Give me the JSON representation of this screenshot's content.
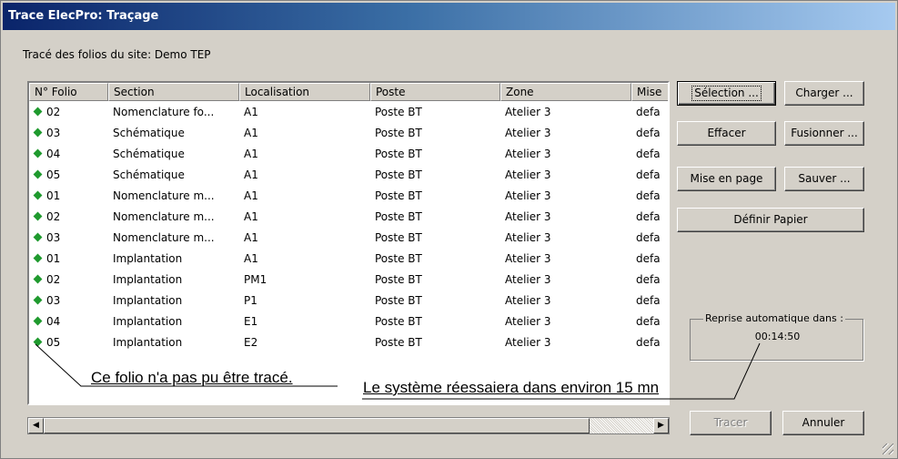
{
  "window": {
    "title": "Trace ElecPro: Traçage"
  },
  "subtitle": "Tracé des folios du site: Demo TEP",
  "table": {
    "headers": [
      "N° Folio",
      "Section",
      "Localisation",
      "Poste",
      "Zone",
      "Mise"
    ],
    "rows": [
      {
        "folio": "02",
        "section": "Nomenclature fo...",
        "loc": "A1",
        "poste": "Poste BT",
        "zone": "Atelier 3",
        "mise": "defa"
      },
      {
        "folio": "03",
        "section": "Schématique",
        "loc": "A1",
        "poste": "Poste BT",
        "zone": "Atelier 3",
        "mise": "defa"
      },
      {
        "folio": "04",
        "section": "Schématique",
        "loc": "A1",
        "poste": "Poste BT",
        "zone": "Atelier 3",
        "mise": "defa"
      },
      {
        "folio": "05",
        "section": "Schématique",
        "loc": "A1",
        "poste": "Poste BT",
        "zone": "Atelier 3",
        "mise": "defa"
      },
      {
        "folio": "01",
        "section": "Nomenclature m...",
        "loc": "A1",
        "poste": "Poste BT",
        "zone": "Atelier 3",
        "mise": "defa"
      },
      {
        "folio": "02",
        "section": "Nomenclature m...",
        "loc": "A1",
        "poste": "Poste BT",
        "zone": "Atelier 3",
        "mise": "defa"
      },
      {
        "folio": "03",
        "section": "Nomenclature m...",
        "loc": "A1",
        "poste": "Poste BT",
        "zone": "Atelier 3",
        "mise": "defa"
      },
      {
        "folio": "01",
        "section": "Implantation",
        "loc": "A1",
        "poste": "Poste BT",
        "zone": "Atelier 3",
        "mise": "defa"
      },
      {
        "folio": "02",
        "section": "Implantation",
        "loc": "PM1",
        "poste": "Poste BT",
        "zone": "Atelier 3",
        "mise": "defa"
      },
      {
        "folio": "03",
        "section": "Implantation",
        "loc": "P1",
        "poste": "Poste BT",
        "zone": "Atelier 3",
        "mise": "defa"
      },
      {
        "folio": "04",
        "section": "Implantation",
        "loc": "E1",
        "poste": "Poste BT",
        "zone": "Atelier 3",
        "mise": "defa"
      },
      {
        "folio": "05",
        "section": "Implantation",
        "loc": "E2",
        "poste": "Poste BT",
        "zone": "Atelier 3",
        "mise": "defa"
      }
    ],
    "status_icon": "green-diamond-icon",
    "status_color": "#1f9a2e"
  },
  "annotations": {
    "folio_not_traced": "Ce folio n'a pas pu être tracé.",
    "retry": "Le système réessaiera dans environ 15 mn"
  },
  "buttons": {
    "selection": "Sélection ...",
    "charger": "Charger ...",
    "effacer": "Effacer",
    "fusionner": "Fusionner ...",
    "mise_en_page": "Mise en page",
    "sauver": "Sauver ...",
    "definir_papier": "Définir Papier",
    "tracer": "Tracer",
    "annuler": "Annuler"
  },
  "auto_resume": {
    "label": "Reprise automatique dans :",
    "time": "00:14:50"
  },
  "icons": {
    "scroll_left": "◀",
    "scroll_right": "▶"
  }
}
